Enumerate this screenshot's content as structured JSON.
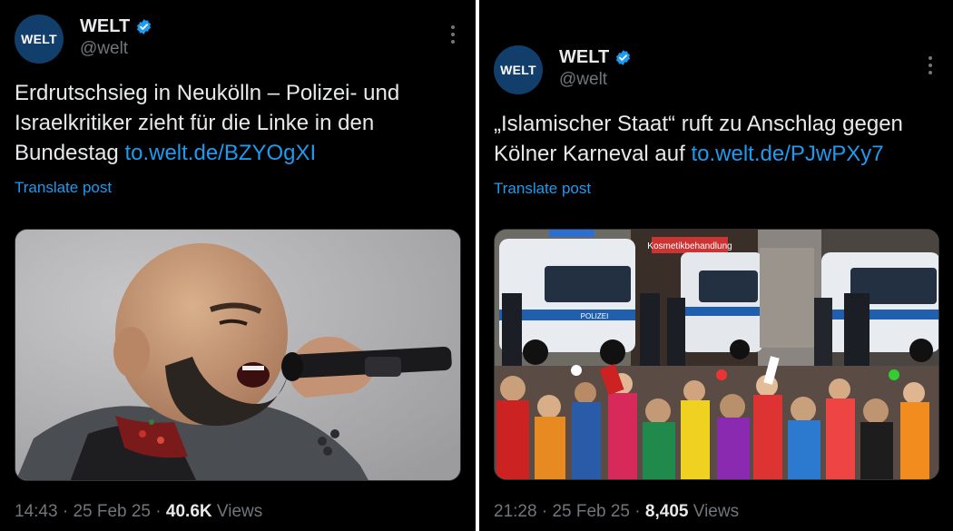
{
  "posts": [
    {
      "account": {
        "name": "WELT",
        "handle": "@welt",
        "avatar_text": "WELT"
      },
      "text": "Erdrutschsieg in Neukölln – Polizei- und Israelkritiker zieht für die Linke in den Bundestag",
      "link": "to.welt.de/BZYOgXI",
      "translate_label": "Translate post",
      "time": "14:43",
      "date": "25 Feb 25",
      "views_count": "40.6K",
      "views_label": "Views",
      "image_icon": "photo-man-singing-microphone"
    },
    {
      "account": {
        "name": "WELT",
        "handle": "@welt",
        "avatar_text": "WELT"
      },
      "text": "„Islamischer Staat“ ruft zu Anschlag gegen Kölner Karneval auf",
      "link": "to.welt.de/PJwPXy7",
      "translate_label": "Translate post",
      "time": "21:28",
      "date": "25 Feb 25",
      "views_count": "8,405",
      "views_label": "Views",
      "image_icon": "photo-police-vans-carnival-crowd",
      "image_texts": {
        "shop_sign": "Kosmetikbehandlung",
        "van_label": "POLIZEI"
      }
    }
  ],
  "separator": "·",
  "colors": {
    "background": "#000000",
    "link": "#1d9bf0",
    "muted": "#71767b",
    "text": "#e7e9ea",
    "verified": "#1d9bf0",
    "avatar": "#123e6b"
  }
}
